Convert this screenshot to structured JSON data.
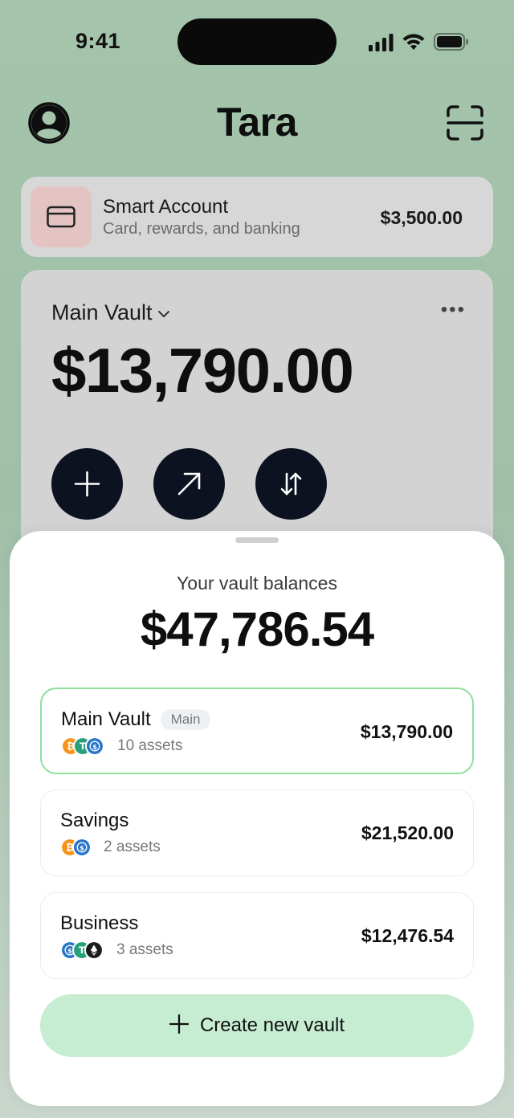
{
  "status_bar": {
    "time": "9:41"
  },
  "header": {
    "title": "Tara"
  },
  "smart_account": {
    "title": "Smart Account",
    "subtitle": "Card, rewards, and banking",
    "amount": "$3,500.00"
  },
  "vault_card": {
    "name": "Main Vault",
    "amount": "$13,790.00"
  },
  "sheet": {
    "label": "Your vault balances",
    "total": "$47,786.54",
    "vaults": [
      {
        "name": "Main Vault",
        "badge": "Main",
        "assets": "10 assets",
        "amount": "$13,790.00",
        "selected": true,
        "coins": [
          "bitcoin",
          "tether",
          "usdc"
        ]
      },
      {
        "name": "Savings",
        "badge": "",
        "assets": "2 assets",
        "amount": "$21,520.00",
        "selected": false,
        "coins": [
          "bitcoin",
          "usdc"
        ]
      },
      {
        "name": "Business",
        "badge": "",
        "assets": "3 assets",
        "amount": "$12,476.54",
        "selected": false,
        "coins": [
          "usdc",
          "tether",
          "ethereum"
        ]
      }
    ],
    "create_label": "Create new vault"
  },
  "colors": {
    "background": "#a6c5ad",
    "accent_green": "#c6ecd1",
    "selected_border": "#8ee09a",
    "action_button": "#0c1220",
    "bitcoin": "#f7931a",
    "tether": "#26a17b",
    "usdc": "#2775ca",
    "ethereum": "#1b1b1b"
  },
  "icons": {
    "avatar": "user-circle-icon",
    "scan": "scan-frame-icon",
    "card": "credit-card-icon",
    "add": "plus-icon",
    "send": "arrow-up-right-icon",
    "swap": "swap-vertical-icon"
  }
}
